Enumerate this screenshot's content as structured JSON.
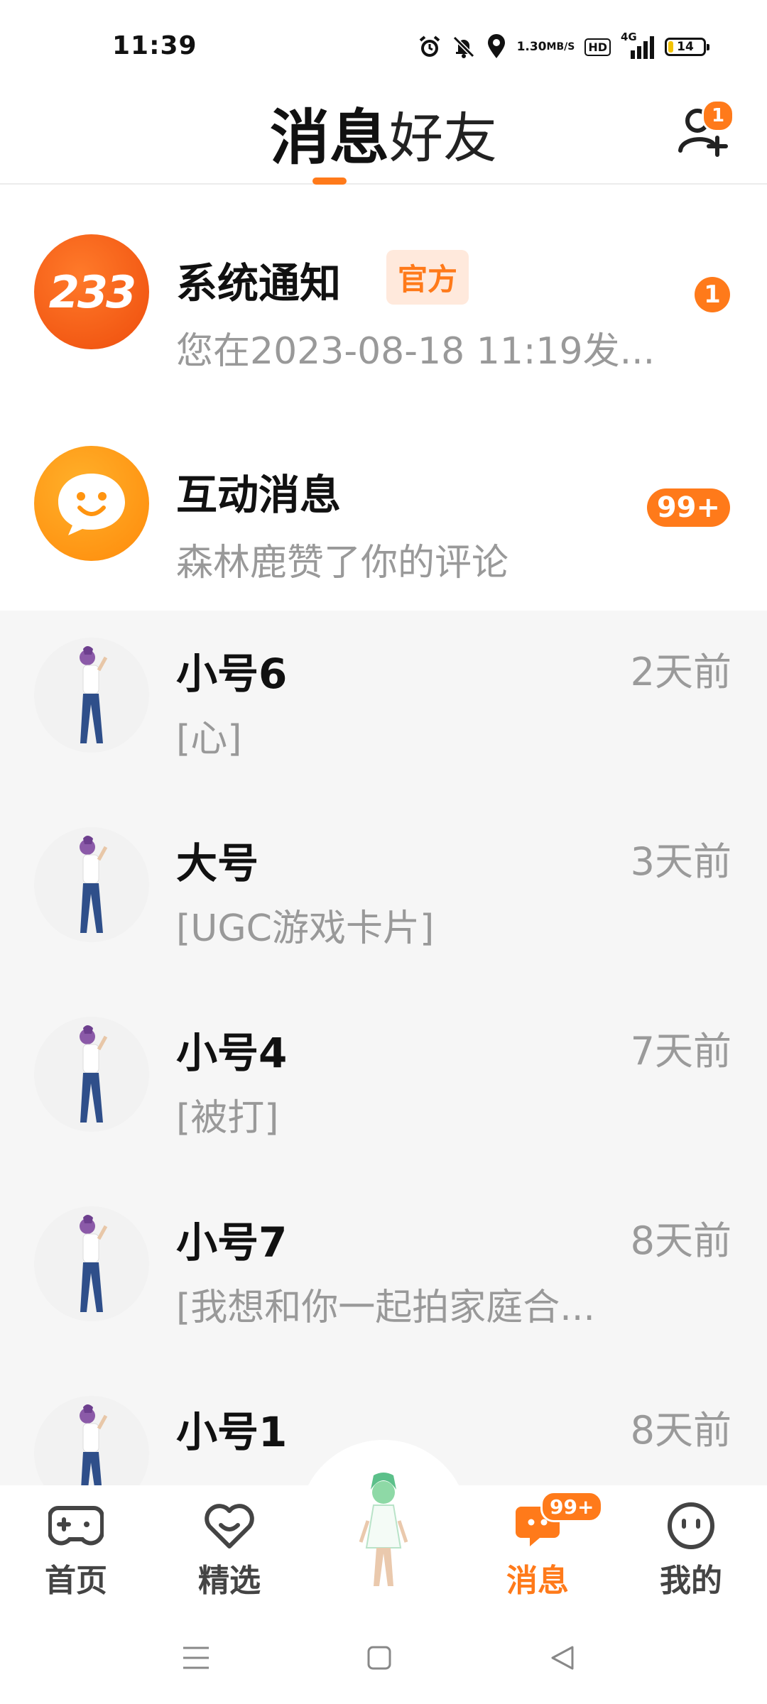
{
  "status_bar": {
    "time": "11:39",
    "net_speed_value": "1.30",
    "net_speed_unit": "MB/S",
    "hd_label": "HD",
    "network_label": "4G",
    "battery_level": "14",
    "battery_fraction": 0.14,
    "icons": [
      "alarm-icon",
      "mute-icon",
      "location-icon",
      "signal-icon",
      "battery-icon"
    ]
  },
  "header": {
    "tabs": [
      {
        "label": "消息",
        "active": true
      },
      {
        "label": "好友",
        "active": false
      }
    ],
    "add_friend_badge": "1"
  },
  "messages": {
    "system": {
      "avatar_text": "233",
      "name": "系统通知",
      "tag": "官方",
      "preview": "您在2023-08-18 11:19发...",
      "badge": "1"
    },
    "interaction": {
      "name": "互动消息",
      "preview": "森林鹿赞了你的评论",
      "badge": "99+"
    },
    "chats": [
      {
        "name": "小号6",
        "preview": "[心]",
        "time": "2天前"
      },
      {
        "name": "大号",
        "preview": "[UGC游戏卡片]",
        "time": "3天前"
      },
      {
        "name": "小号4",
        "preview": "[被打]",
        "time": "7天前"
      },
      {
        "name": "小号7",
        "preview": "[我想和你一起拍家庭合...",
        "time": "8天前"
      },
      {
        "name": "小号1",
        "preview": "",
        "time": "8天前"
      }
    ]
  },
  "bottom_nav": {
    "items": [
      {
        "label": "首页",
        "icon": "gamepad-icon",
        "active": false
      },
      {
        "label": "精选",
        "icon": "heart-icon",
        "active": false
      },
      {
        "label": "消息",
        "icon": "chat-icon",
        "active": true,
        "badge": "99+"
      },
      {
        "label": "我的",
        "icon": "smiley-icon",
        "active": false
      }
    ]
  },
  "colors": {
    "accent": "#ff7a1a",
    "list_gray": "#f6f6f6",
    "muted_text": "#999999"
  }
}
